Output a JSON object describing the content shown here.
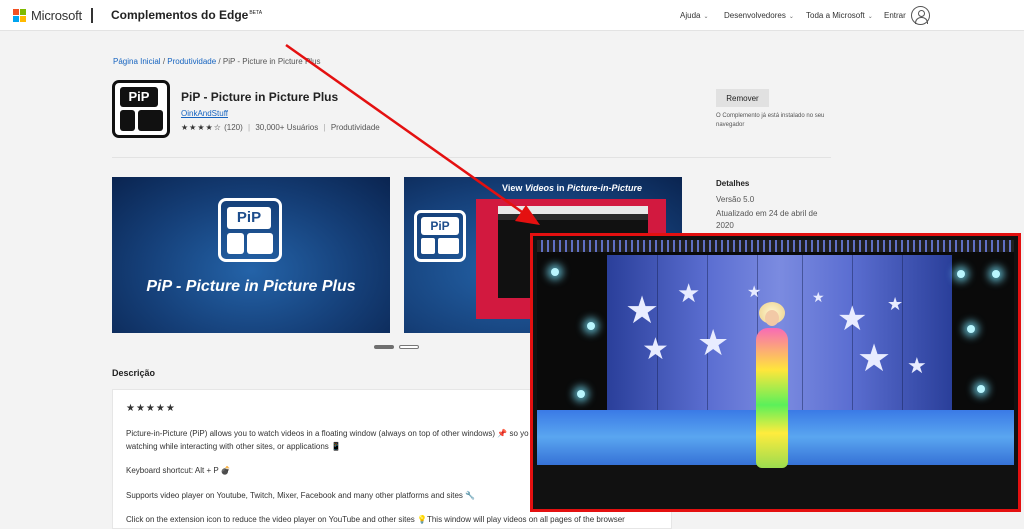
{
  "header": {
    "brand": "Microsoft",
    "site_title": "Complementos do Edge",
    "site_badge": "BETA",
    "nav": [
      "Ajuda",
      "Desenvolvedores",
      "Toda a Microsoft"
    ],
    "signin": "Entrar",
    "logo_colors": [
      "#f25022",
      "#7fba00",
      "#00a4ef",
      "#ffb900"
    ]
  },
  "breadcrumb": {
    "home": "Página Inicial",
    "category": "Produtividade",
    "current": "PiP - Picture in Picture Plus"
  },
  "app": {
    "icon_label": "PiP",
    "name": "PiP - Picture in Picture Plus",
    "publisher": "OinkAndStuff",
    "rating_stars": "★★★★☆",
    "rating_count": "(120)",
    "users": "30,000+ Usuários",
    "category": "Produtividade",
    "remove_label": "Remover",
    "install_note": "O Complemento já está instalado no seu navegador"
  },
  "screenshots": {
    "one_icon_label": "PiP",
    "one_caption": "PiP - Picture in Picture Plus",
    "two_title_prefix": "View ",
    "two_title_videos": "Videos",
    "two_title_mid": " in ",
    "two_title_pip": "Picture-in-Picture",
    "two_icon_label": "PiP"
  },
  "details": {
    "heading": "Detalhes",
    "version": "Versão 5.0",
    "updated": "Atualizado em 24 de abril de 2020"
  },
  "description": {
    "heading": "Descrição",
    "stars": "★★★★★",
    "line1": "Picture-in-Picture (PiP) allows you to watch videos in a floating window (always on top of other windows) 📌 so yo",
    "line2": "watching while interacting with other sites, or applications 📱",
    "line3": "Keyboard shortcut: Alt + P 💣",
    "line4": "Supports video player on Youtube, Twitch, Mixer, Facebook and many other platforms and sites 🔧",
    "line5": "Click on the extension icon to reduce the video player on YouTube and other sites 💡This window will play videos on all pages of the browser"
  },
  "colors": {
    "link": "#1664c0",
    "arrow": "#e41010",
    "pip_border": "#e41010"
  }
}
